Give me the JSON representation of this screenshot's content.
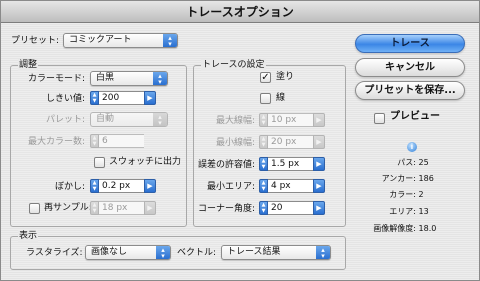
{
  "window": {
    "title": "トレースオプション"
  },
  "preset": {
    "label": "プリセット:",
    "value": "コミックアート"
  },
  "adjust": {
    "title": "調整",
    "mode_label": "カラーモード:",
    "mode_value": "白黒",
    "threshold_label": "しきい値:",
    "threshold_value": "200",
    "palette_label": "パレット:",
    "palette_value": "自動",
    "maxcolors_label": "最大カラー数:",
    "maxcolors_value": "6",
    "swatch_label": "スウォッチに出力",
    "blur_label": "ぼかし:",
    "blur_value": "0.2 px",
    "resample_label": "再サンプル:",
    "resample_value": "18 px"
  },
  "trace": {
    "title": "トレースの設定",
    "fill_label": "塗り",
    "fill_checked": "✓",
    "stroke_label": "線",
    "maxstroke_label": "最大線幅:",
    "maxstroke_value": "10 px",
    "minstroke_label": "最小線幅:",
    "minstroke_value": "20 px",
    "tolerance_label": "誤差の許容値:",
    "tolerance_value": "1.5 px",
    "minarea_label": "最小エリア:",
    "minarea_value": "4 px",
    "corner_label": "コーナー角度:",
    "corner_value": "20"
  },
  "display": {
    "title": "表示",
    "raster_label": "ラスタライズ:",
    "raster_value": "画像なし",
    "vector_label": "ベクトル:",
    "vector_value": "トレース結果"
  },
  "buttons": {
    "trace": "トレース",
    "cancel": "キャンセル",
    "save_preset": "プリセットを保存..."
  },
  "preview": {
    "label": "プレビュー"
  },
  "info_icon": "info-icon",
  "stats": [
    {
      "key": "パス:",
      "value": "25"
    },
    {
      "key": "アンカー:",
      "value": "186"
    },
    {
      "key": "カラー:",
      "value": "2"
    },
    {
      "key": "エリア:",
      "value": "13"
    },
    {
      "key": "画像解像度:",
      "value": "18.0"
    }
  ]
}
